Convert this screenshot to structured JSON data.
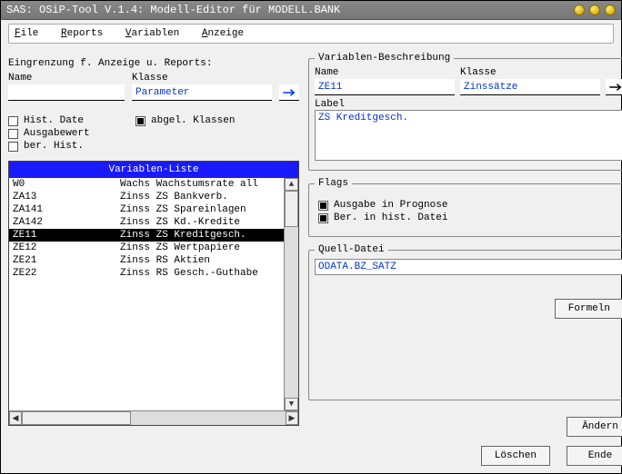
{
  "window_title": "SAS: OSiP-Tool V.1.4: Modell-Editor für MODELL.BANK",
  "menu": {
    "file": "File",
    "reports": "Reports",
    "variablen": "Variablen",
    "anzeige": "Anzeige"
  },
  "filters": {
    "heading": "Eingrenzung f. Anzeige u. Reports:",
    "name_label": "Name",
    "name_value": "",
    "klasse_label": "Klasse",
    "klasse_value": "Parameter",
    "hist_date": "Hist. Date",
    "ausgabewert": "Ausgabewert",
    "ber_hist": "ber. Hist.",
    "abgel_klassen": "abgel. Klassen"
  },
  "variablen_liste": {
    "title": "Variablen-Liste",
    "rows": [
      {
        "code": "W0",
        "desc": "Wachs Wachstumsrate all"
      },
      {
        "code": "ZA13",
        "desc": "Zinss ZS Bankverb."
      },
      {
        "code": "ZA141",
        "desc": "Zinss ZS Spareinlagen"
      },
      {
        "code": "ZA142",
        "desc": "Zinss ZS Kd.-Kredite"
      },
      {
        "code": "ZE11",
        "desc": "Zinss ZS Kreditgesch."
      },
      {
        "code": "ZE12",
        "desc": "Zinss ZS Wertpapiere"
      },
      {
        "code": "ZE21",
        "desc": "Zinss RS Aktien"
      },
      {
        "code": "ZE22",
        "desc": "Zinss RS Gesch.-Guthabe"
      }
    ],
    "selected_index": 4
  },
  "beschreibung": {
    "legend": "Variablen-Beschreibung",
    "name_label": "Name",
    "name_value": "ZE11",
    "klasse_label": "Klasse",
    "klasse_value": "Zinssätze",
    "label_label": "Label",
    "label_value": "ZS Kreditgesch."
  },
  "flags": {
    "legend": "Flags",
    "ausgabe": "Ausgabe in Prognose",
    "ber_hist": "Ber. in hist. Datei"
  },
  "quell": {
    "legend": "Quell-Datei",
    "value": "ODATA.BZ_SATZ"
  },
  "buttons": {
    "formeln": "Formeln",
    "aendern": "Ändern",
    "loeschen": "Löschen",
    "ende": "Ende"
  }
}
